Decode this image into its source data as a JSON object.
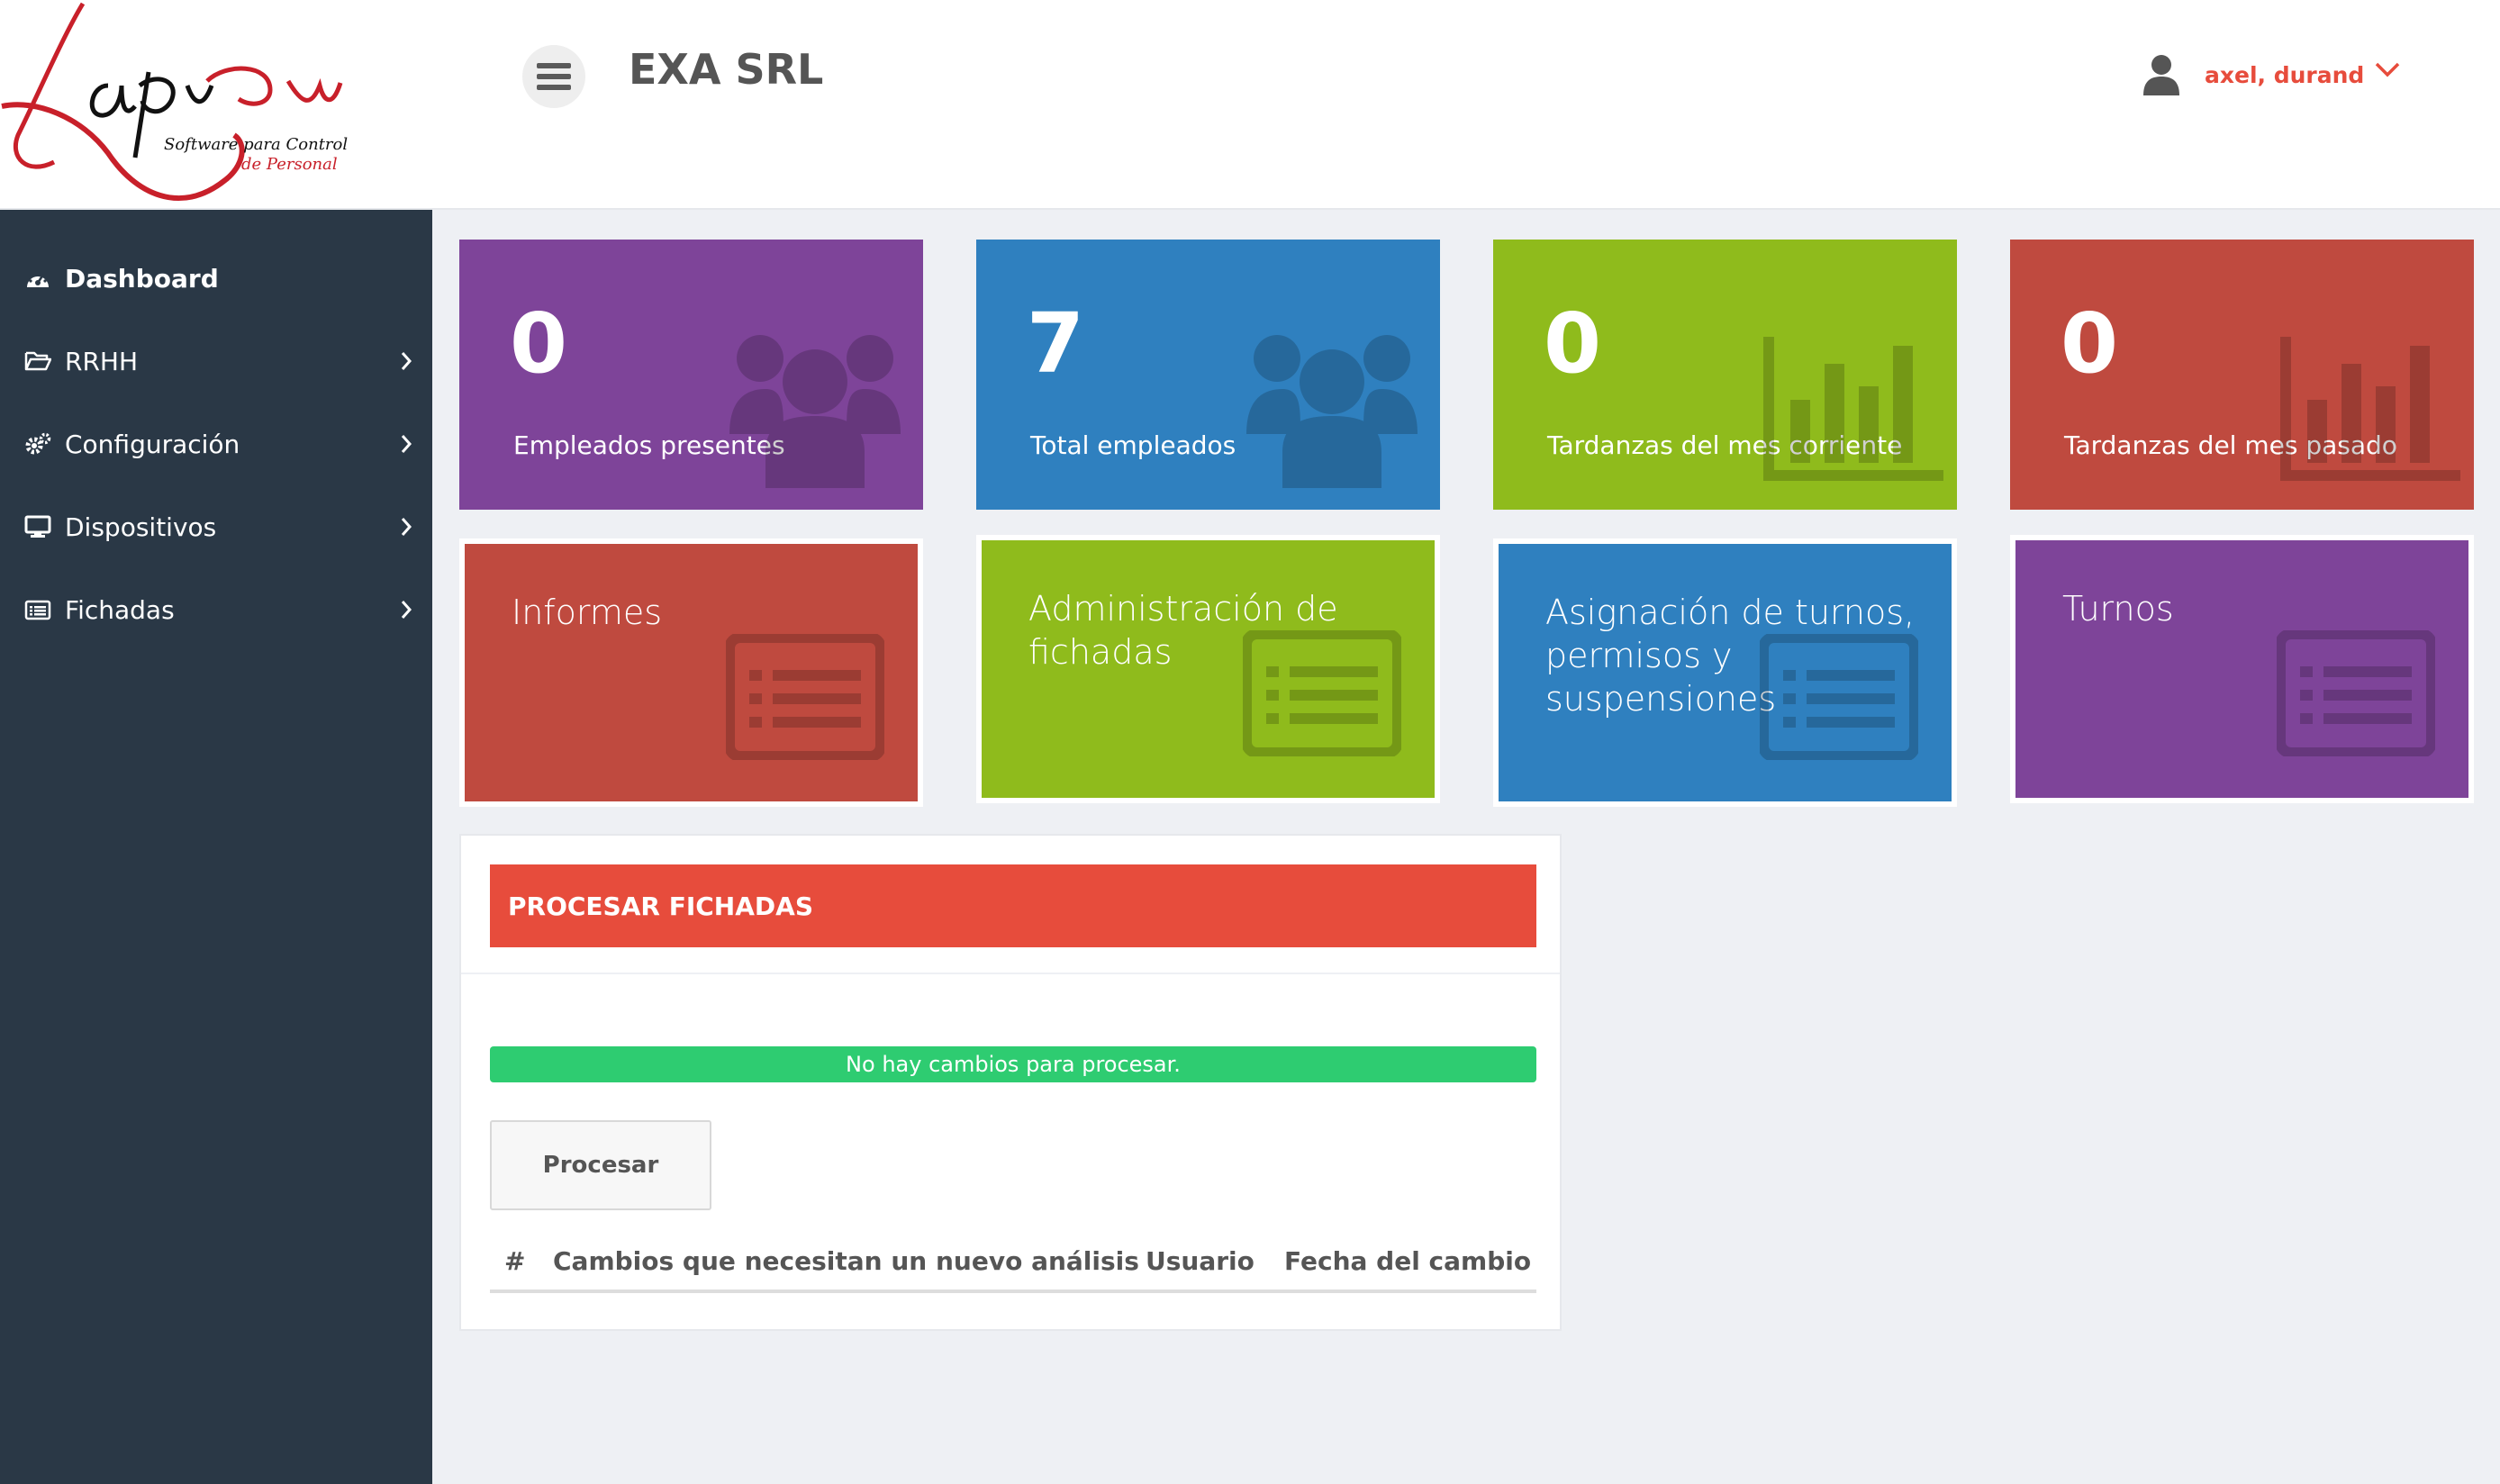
{
  "app": {
    "logo_text": "Lapsus",
    "logo_tagline_1": "Software para Control",
    "logo_tagline_2": "de Personal"
  },
  "header": {
    "company": "EXA SRL",
    "user_name": "axel, durand"
  },
  "sidebar": {
    "items": [
      {
        "label": "Dashboard",
        "icon": "dashboard-icon"
      },
      {
        "label": "RRHH",
        "icon": "folder-open-icon"
      },
      {
        "label": "Configuración",
        "icon": "gears-icon"
      },
      {
        "label": "Dispositivos",
        "icon": "desktop-icon"
      },
      {
        "label": "Fichadas",
        "icon": "list-alt-icon"
      }
    ]
  },
  "stats": [
    {
      "value": "0",
      "label": "Empleados presentes",
      "color": "#7e4499",
      "icon": "users-icon"
    },
    {
      "value": "7",
      "label": "Total empleados",
      "color": "#2f80bf",
      "icon": "users-icon"
    },
    {
      "value": "0",
      "label": "Tardanzas del mes corriente",
      "color": "#8fbb1c",
      "icon": "bar-chart-icon"
    },
    {
      "value": "0",
      "label": "Tardanzas del mes pasado",
      "color": "#bf4a3f",
      "icon": "bar-chart-icon"
    }
  ],
  "actions": [
    {
      "label": "Informes",
      "color": "#bf4a3f"
    },
    {
      "label": "Administración de fichadas",
      "color": "#8fbb1c"
    },
    {
      "label": "Asignación de turnos, permisos y suspensiones",
      "color": "#2f80bf"
    },
    {
      "label": "Turnos",
      "color": "#7e4499"
    }
  ],
  "panel": {
    "title": "PROCESAR FICHADAS",
    "alert": "No hay cambios para procesar.",
    "button": "Procesar",
    "columns": [
      "#",
      "Cambios que necesitan un nuevo análisis",
      "Usuario",
      "Fecha del cambio"
    ]
  }
}
